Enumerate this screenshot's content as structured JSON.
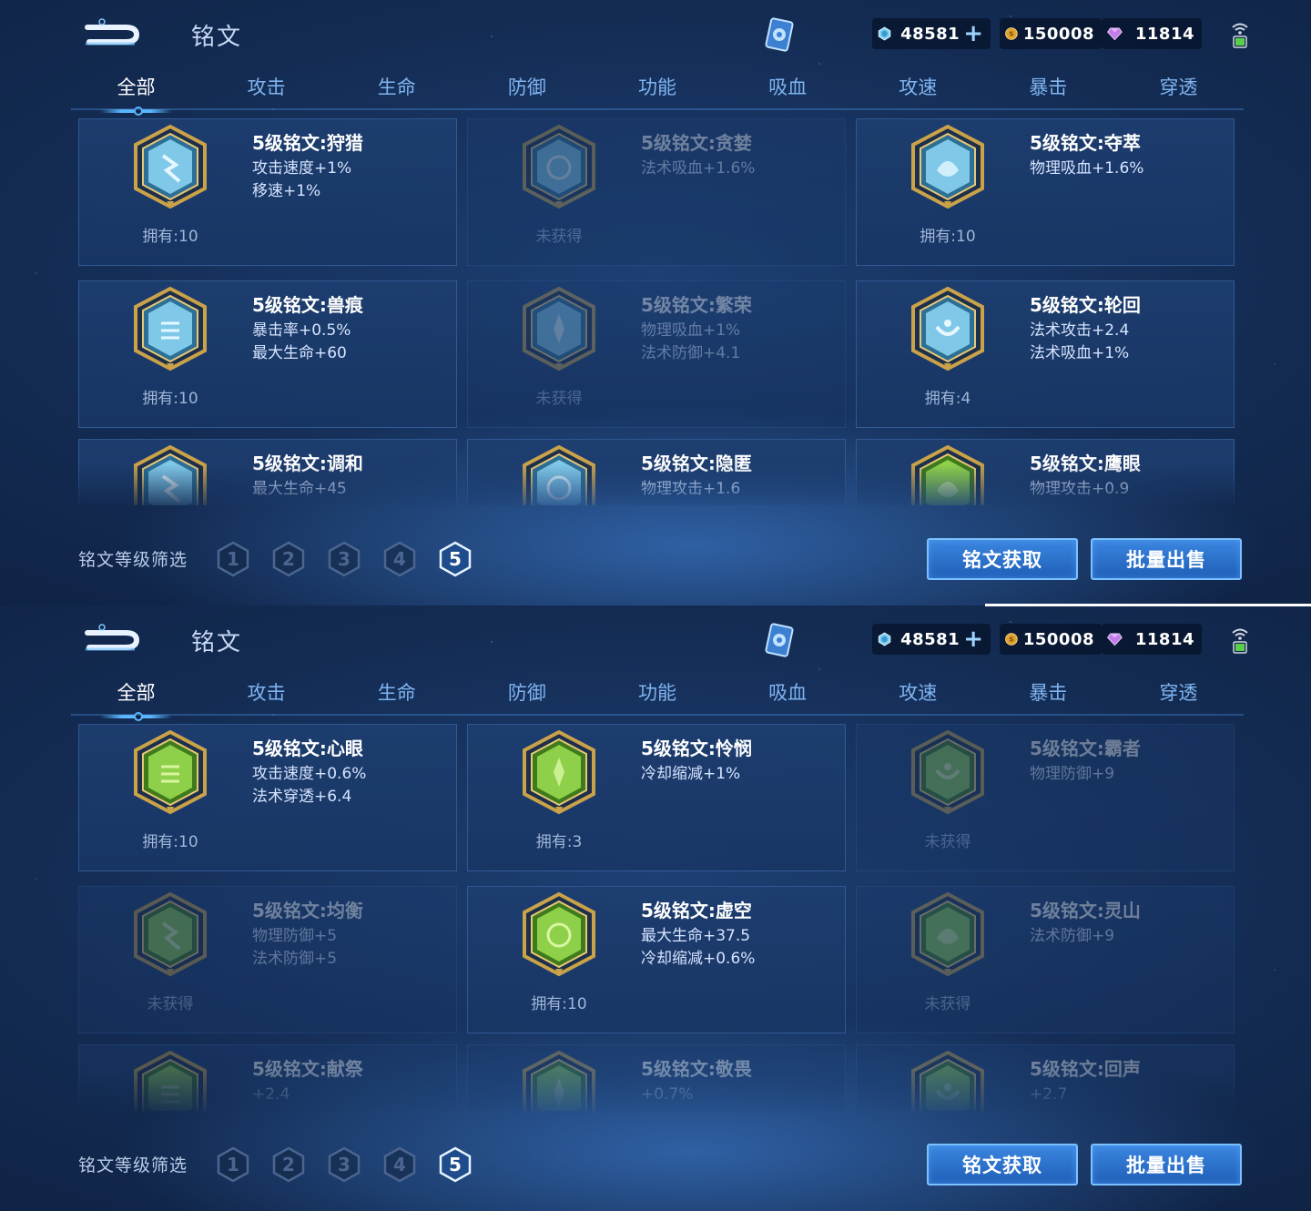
{
  "header": {
    "title": "铭文",
    "currencies": [
      {
        "name": "gem",
        "value": "48581"
      },
      {
        "name": "coin",
        "value": "150008"
      },
      {
        "name": "diamond",
        "value": "11814"
      }
    ]
  },
  "tabs": [
    "全部",
    "攻击",
    "生命",
    "防御",
    "功能",
    "吸血",
    "攻速",
    "暴击",
    "穿透"
  ],
  "active_tab": "全部",
  "filter": {
    "label": "铭文等级筛选",
    "levels": [
      "1",
      "2",
      "3",
      "4",
      "5"
    ],
    "selected": "5"
  },
  "buttons": {
    "obtain": "铭文获取",
    "sell": "批量出售"
  },
  "colors": {
    "blue_rune": "#7fc8e8",
    "green_rune": "#7cc43e",
    "gold_frame": "#c9a24a",
    "accent": "#5ab8ff"
  },
  "screens": [
    {
      "cards": [
        {
          "name": "5级铭文:狩猎",
          "attrs": [
            "攻击速度+1%",
            "移速+1%"
          ],
          "owned": "拥有:10",
          "locked": false,
          "color": "blue"
        },
        {
          "name": "5级铭文:贪婪",
          "attrs": [
            "法术吸血+1.6%"
          ],
          "owned": "未获得",
          "locked": true,
          "color": "blue"
        },
        {
          "name": "5级铭文:夺萃",
          "attrs": [
            "物理吸血+1.6%"
          ],
          "owned": "拥有:10",
          "locked": false,
          "color": "blue"
        },
        {
          "name": "5级铭文:兽痕",
          "attrs": [
            "暴击率+0.5%",
            "最大生命+60"
          ],
          "owned": "拥有:10",
          "locked": false,
          "color": "blue"
        },
        {
          "name": "5级铭文:繁荣",
          "attrs": [
            "物理吸血+1%",
            "法术防御+4.1"
          ],
          "owned": "未获得",
          "locked": true,
          "color": "blue"
        },
        {
          "name": "5级铭文:轮回",
          "attrs": [
            "法术攻击+2.4",
            "法术吸血+1%"
          ],
          "owned": "拥有:4",
          "locked": false,
          "color": "blue"
        },
        {
          "name": "5级铭文:调和",
          "attrs": [
            "最大生命+45"
          ],
          "owned": "",
          "locked": false,
          "color": "blue"
        },
        {
          "name": "5级铭文:隐匿",
          "attrs": [
            "物理攻击+1.6"
          ],
          "owned": "",
          "locked": false,
          "color": "blue"
        },
        {
          "name": "5级铭文:鹰眼",
          "attrs": [
            "物理攻击+0.9"
          ],
          "owned": "",
          "locked": false,
          "color": "green"
        }
      ]
    },
    {
      "cards": [
        {
          "name": "5级铭文:心眼",
          "attrs": [
            "攻击速度+0.6%",
            "法术穿透+6.4"
          ],
          "owned": "拥有:10",
          "locked": false,
          "color": "green"
        },
        {
          "name": "5级铭文:怜悯",
          "attrs": [
            "冷却缩减+1%"
          ],
          "owned": "拥有:3",
          "locked": false,
          "color": "green"
        },
        {
          "name": "5级铭文:霸者",
          "attrs": [
            "物理防御+9"
          ],
          "owned": "未获得",
          "locked": true,
          "color": "green"
        },
        {
          "name": "5级铭文:均衡",
          "attrs": [
            "物理防御+5",
            "法术防御+5"
          ],
          "owned": "未获得",
          "locked": true,
          "color": "green"
        },
        {
          "name": "5级铭文:虚空",
          "attrs": [
            "最大生命+37.5",
            "冷却缩减+0.6%"
          ],
          "owned": "拥有:10",
          "locked": false,
          "color": "green"
        },
        {
          "name": "5级铭文:灵山",
          "attrs": [
            "法术防御+9"
          ],
          "owned": "未获得",
          "locked": true,
          "color": "green"
        },
        {
          "name": "5级铭文:献祭",
          "attrs": [
            "+2.4"
          ],
          "owned": "",
          "locked": true,
          "color": "green"
        },
        {
          "name": "5级铭文:敬畏",
          "attrs": [
            "+0.7%"
          ],
          "owned": "",
          "locked": true,
          "color": "green"
        },
        {
          "name": "5级铭文:回声",
          "attrs": [
            "+2.7"
          ],
          "owned": "",
          "locked": true,
          "color": "green"
        }
      ]
    }
  ]
}
